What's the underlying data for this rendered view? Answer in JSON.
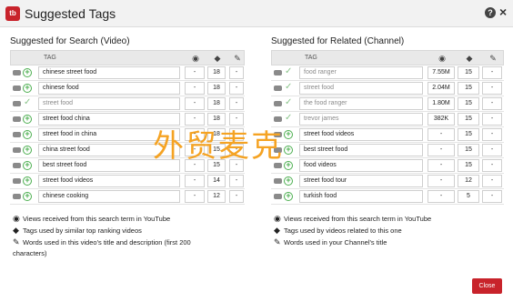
{
  "header": {
    "logo_text": "tb",
    "title": "Suggested Tags",
    "help_glyph": "?",
    "close_glyph": "×"
  },
  "search": {
    "title": "Suggested for Search (Video)",
    "column_tag": "TAG",
    "rows": [
      {
        "tag": "chinese street food",
        "views": "-",
        "similar": "18",
        "words": "-",
        "state": "add"
      },
      {
        "tag": "chinese food",
        "views": "-",
        "similar": "18",
        "words": "-",
        "state": "add"
      },
      {
        "tag": "street food",
        "views": "-",
        "similar": "18",
        "words": "-",
        "state": "added"
      },
      {
        "tag": "street food china",
        "views": "-",
        "similar": "18",
        "words": "-",
        "state": "add"
      },
      {
        "tag": "street food in china",
        "views": "-",
        "similar": "18",
        "words": "-",
        "state": "add"
      },
      {
        "tag": "china street food",
        "views": "-",
        "similar": "15",
        "words": "-",
        "state": "add"
      },
      {
        "tag": "best street food",
        "views": "-",
        "similar": "15",
        "words": "-",
        "state": "add"
      },
      {
        "tag": "street food videos",
        "views": "-",
        "similar": "14",
        "words": "-",
        "state": "add"
      },
      {
        "tag": "chinese cooking",
        "views": "-",
        "similar": "12",
        "words": "-",
        "state": "add"
      }
    ],
    "legend": [
      {
        "icon": "eye-icon",
        "text": "Views received from this search term in YouTube"
      },
      {
        "icon": "tag-icon",
        "text": "Tags used by similar top ranking videos"
      },
      {
        "icon": "pencil-icon",
        "text": "Words used in this video's title and description (first 200"
      },
      {
        "icon": "",
        "text": "characters)"
      }
    ]
  },
  "related": {
    "title": "Suggested for Related (Channel)",
    "column_tag": "TAG",
    "rows": [
      {
        "tag": "food ranger",
        "views": "7.55M",
        "similar": "15",
        "words": "-",
        "state": "added"
      },
      {
        "tag": "street food",
        "views": "2.04M",
        "similar": "15",
        "words": "-",
        "state": "added"
      },
      {
        "tag": "the food ranger",
        "views": "1.80M",
        "similar": "15",
        "words": "-",
        "state": "added"
      },
      {
        "tag": "trevor james",
        "views": "382K",
        "similar": "15",
        "words": "-",
        "state": "added"
      },
      {
        "tag": "street food videos",
        "views": "-",
        "similar": "15",
        "words": "-",
        "state": "add"
      },
      {
        "tag": "best street food",
        "views": "-",
        "similar": "15",
        "words": "-",
        "state": "add"
      },
      {
        "tag": "food videos",
        "views": "-",
        "similar": "15",
        "words": "-",
        "state": "add"
      },
      {
        "tag": "street food tour",
        "views": "-",
        "similar": "12",
        "words": "-",
        "state": "add"
      },
      {
        "tag": "turkish food",
        "views": "-",
        "similar": "5",
        "words": "-",
        "state": "add"
      }
    ],
    "legend": [
      {
        "icon": "eye-icon",
        "text": "Views received from this search term in YouTube"
      },
      {
        "icon": "tag-icon",
        "text": "Tags used by videos related to this one"
      },
      {
        "icon": "pencil-icon",
        "text": "Words used in your Channel's title"
      }
    ]
  },
  "watermark": "外贸麦克",
  "close_button": "Close",
  "colors": {
    "brand": "#c8232b",
    "add": "#4caf50",
    "header_bg": "#f2f2f2",
    "watermark": "#f5a323"
  }
}
